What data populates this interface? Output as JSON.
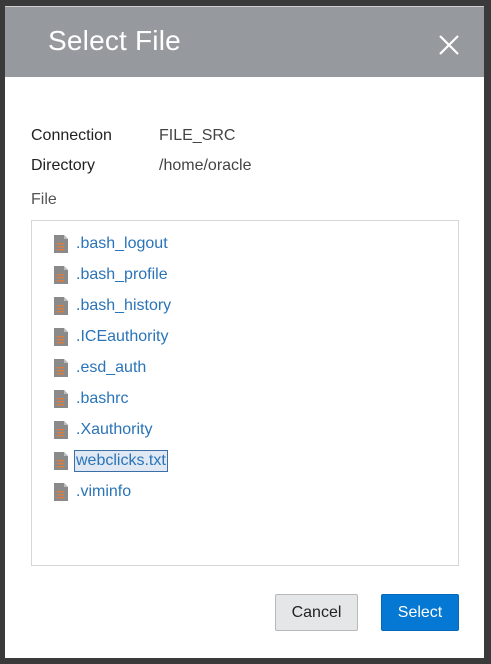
{
  "dialog": {
    "title": "Select File",
    "close_icon": "close-icon"
  },
  "info": {
    "connection_label": "Connection",
    "connection_value": "FILE_SRC",
    "directory_label": "Directory",
    "directory_value": "/home/oracle"
  },
  "file_section": {
    "label": "File",
    "items": [
      {
        "name": ".bash_logout",
        "selected": false
      },
      {
        "name": ".bash_profile",
        "selected": false
      },
      {
        "name": ".bash_history",
        "selected": false
      },
      {
        "name": ".ICEauthority",
        "selected": false
      },
      {
        "name": ".esd_auth",
        "selected": false
      },
      {
        "name": ".bashrc",
        "selected": false
      },
      {
        "name": ".Xauthority",
        "selected": false
      },
      {
        "name": "webclicks.txt",
        "selected": true
      },
      {
        "name": ".viminfo",
        "selected": false
      }
    ],
    "item_icon": "file-icon"
  },
  "buttons": {
    "cancel_label": "Cancel",
    "select_label": "Select"
  },
  "colors": {
    "header_bg": "#96999e",
    "link": "#2a74b8",
    "primary": "#0578d4"
  }
}
